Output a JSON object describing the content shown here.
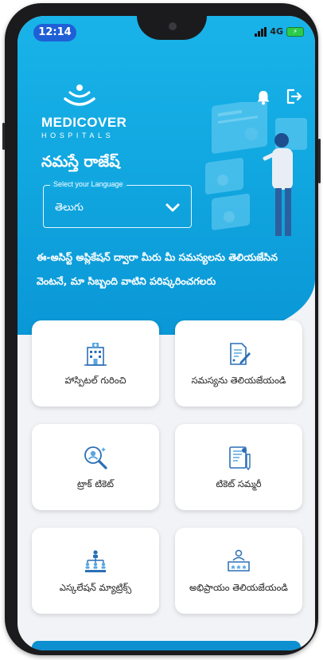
{
  "status_bar": {
    "time": "12:14",
    "network": "4G"
  },
  "brand": {
    "name": "MEDICOVER",
    "sub": "HOSPITALS"
  },
  "greeting": "నమస్తే రాజేష్",
  "language": {
    "legend": "Select your Language",
    "value": "తెలుగు"
  },
  "description": "ఈ-అసిస్ట్ అప్లికేషన్ ద్వారా మీరు మీ సమస్యలను తెలియజేసిన వెంటనే, మా సిబ్బంది వాటిని పరిష్కరించగలరు",
  "tiles": [
    {
      "label": "హాస్పిటల్ గురించి",
      "icon": "hospital-icon"
    },
    {
      "label": "సమస్యను తెలియజేయండి",
      "icon": "report-issue-icon"
    },
    {
      "label": "ట్రాక్ టికెట్",
      "icon": "track-ticket-icon"
    },
    {
      "label": "టికెట్ సమ్మరీ",
      "icon": "ticket-summary-icon"
    },
    {
      "label": "ఎస్కలేషన్ మ్యాట్రిక్స్",
      "icon": "escalation-matrix-icon"
    },
    {
      "label": "అభిప్రాయం తెలియజేయండి",
      "icon": "feedback-icon"
    }
  ],
  "colors": {
    "hero": "#14aae3",
    "accent": "#1f5fd6",
    "icon_blue": "#2b6fb6"
  }
}
